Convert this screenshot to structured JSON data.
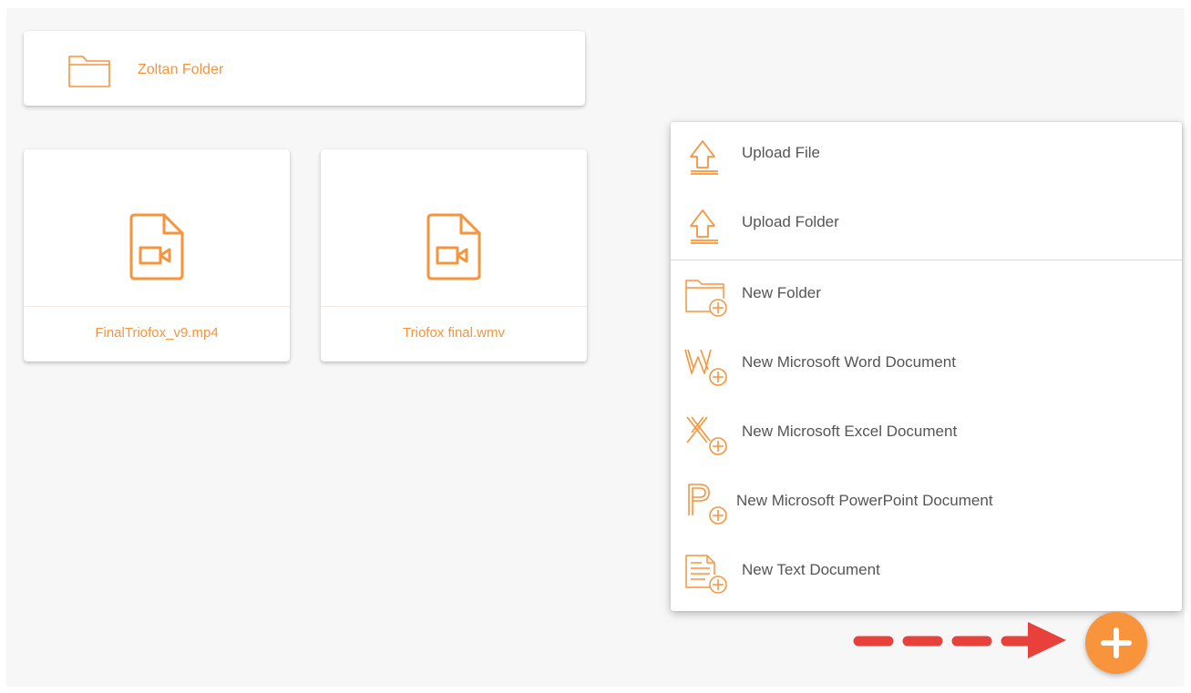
{
  "accent_color": "#f7943c",
  "annotation_arrow_color": "#e8403a",
  "folders": [
    {
      "name": "Zoltan Folder",
      "icon": "folder-icon"
    }
  ],
  "files": [
    {
      "name": "FinalTriofox_v9.mp4",
      "icon": "video-file-icon"
    },
    {
      "name": "Triofox final.wmv",
      "icon": "video-file-icon"
    }
  ],
  "menu": {
    "upload_items": [
      {
        "label": "Upload File",
        "icon": "upload-icon"
      },
      {
        "label": "Upload Folder",
        "icon": "upload-icon"
      }
    ],
    "create_items": [
      {
        "label": "New Folder",
        "icon": "new-folder-icon"
      },
      {
        "label": "New Microsoft Word Document",
        "icon": "new-word-icon"
      },
      {
        "label": "New Microsoft Excel Document",
        "icon": "new-excel-icon"
      },
      {
        "label": "New Microsoft PowerPoint Document",
        "icon": "new-powerpoint-icon"
      },
      {
        "label": "New Text Document",
        "icon": "new-text-icon"
      }
    ]
  },
  "fab": {
    "icon": "plus-icon"
  },
  "annotation": {
    "icon": "dashed-arrow-icon"
  }
}
